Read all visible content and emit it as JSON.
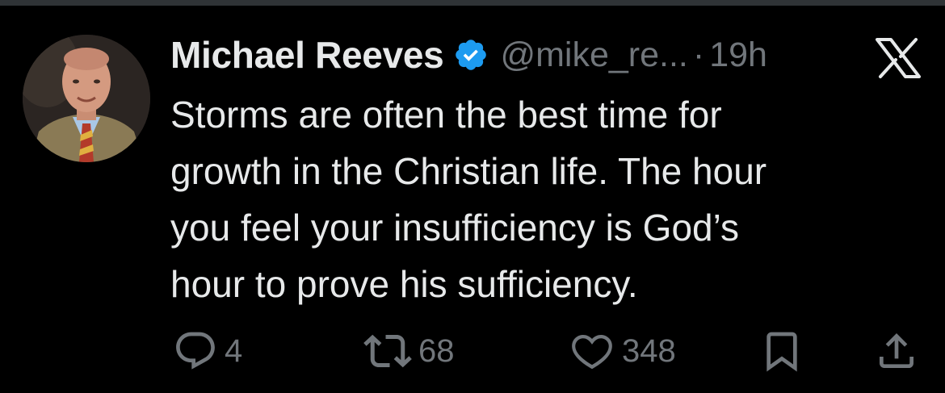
{
  "tweet": {
    "author_name": "Michael Reeves",
    "handle": "@mike_re...",
    "separator": "·",
    "time": "19h",
    "text_lines": [
      "Storms are often the best time for",
      "growth in the Christian life. The hour",
      "you feel your insufficiency is God’s",
      "hour to prove his sufficiency."
    ]
  },
  "actions": {
    "reply_count": "4",
    "retweet_count": "68",
    "like_count": "348"
  },
  "icons": {
    "verified": "verified-badge-icon",
    "brand": "x-logo-icon",
    "reply": "reply-icon",
    "retweet": "retweet-icon",
    "like": "heart-icon",
    "bookmark": "bookmark-icon",
    "share": "share-icon"
  },
  "colors": {
    "background": "#000000",
    "text": "#e7e9ea",
    "secondary": "#71767b",
    "verified": "#1d9bf0"
  }
}
